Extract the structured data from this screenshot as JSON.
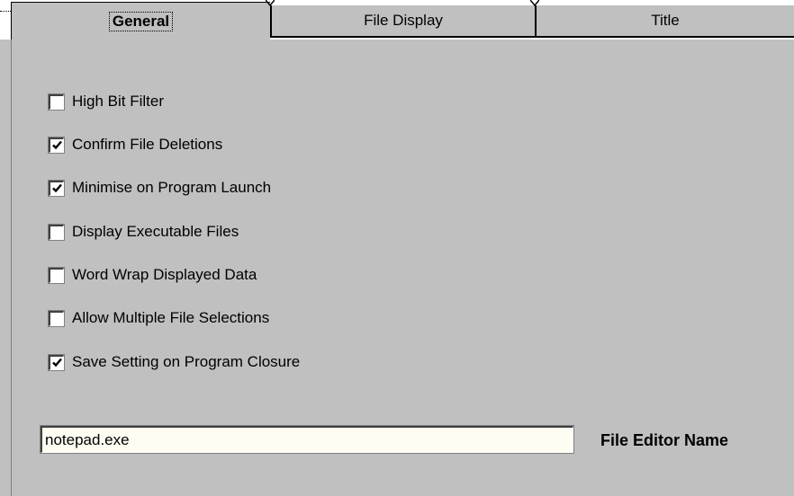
{
  "tabs": [
    {
      "label": "General",
      "active": true
    },
    {
      "label": "File Display",
      "active": false
    },
    {
      "label": "Title",
      "active": false
    }
  ],
  "options": [
    {
      "label": "High Bit Filter",
      "checked": false
    },
    {
      "label": "Confirm File Deletions",
      "checked": true
    },
    {
      "label": "Minimise on Program Launch",
      "checked": true
    },
    {
      "label": "Display Executable Files",
      "checked": false
    },
    {
      "label": "Word Wrap Displayed Data",
      "checked": false
    },
    {
      "label": "Allow Multiple File Selections",
      "checked": false
    },
    {
      "label": "Save Setting on Program Closure",
      "checked": true
    }
  ],
  "file_editor": {
    "value": "notepad.exe",
    "label": "File Editor Name"
  },
  "colors": {
    "dialog_bg": "#c0c0c0",
    "input_bg": "#fffdf2"
  }
}
